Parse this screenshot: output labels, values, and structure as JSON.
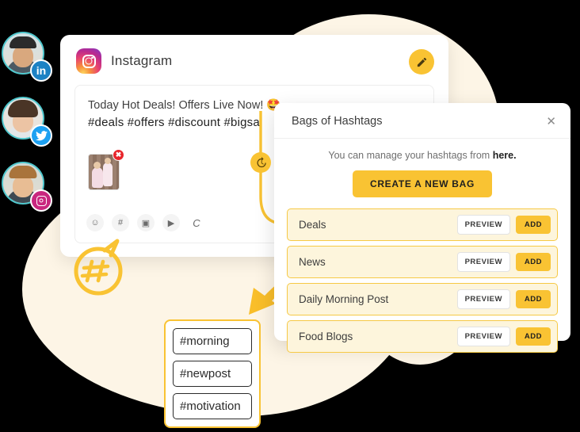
{
  "avatars": [
    {
      "name": "avatar-linkedin",
      "network": "LinkedIn",
      "badge": "in"
    },
    {
      "name": "avatar-twitter",
      "network": "Twitter",
      "badge": "twitter-icon"
    },
    {
      "name": "avatar-instagram",
      "network": "Instagram",
      "badge": "instagram-icon"
    }
  ],
  "composer": {
    "platform": "Instagram",
    "platform_icon": "instagram-logo",
    "edit_icon": "pencil-icon",
    "post_line_1": "Today Hot Deals!  Offers Live Now! 🤩",
    "post_line_2": "#deals #offers #discount #bigsal",
    "attachment_remove": "✖",
    "toolbar": [
      {
        "icon": "emoji-icon",
        "glyph": "☺"
      },
      {
        "icon": "hashtag-icon",
        "glyph": "#"
      },
      {
        "icon": "image-icon",
        "glyph": "▣"
      },
      {
        "icon": "video-icon",
        "glyph": "▶"
      },
      {
        "icon": "character-count-icon",
        "glyph": "C"
      }
    ]
  },
  "history_badge": {
    "icon": "history-clock-icon",
    "glyph": "↺"
  },
  "hash_bubble": {
    "icon": "hashtag-bubble-icon"
  },
  "chips_card": {
    "chips": [
      {
        "label": "#morning"
      },
      {
        "label": "#newpost"
      },
      {
        "label": "#motivation"
      }
    ]
  },
  "bags_panel": {
    "title": "Bags of Hashtags",
    "close_icon": "close-icon",
    "close_glyph": "✕",
    "subtitle_prefix": "You can manage your hashtags from ",
    "subtitle_link": "here.",
    "create_label": "CREATE A NEW BAG",
    "preview_label": "PREVIEW",
    "add_label": "ADD",
    "bags": [
      {
        "name": "Deals"
      },
      {
        "name": "News"
      },
      {
        "name": "Daily Morning Post"
      },
      {
        "name": "Food Blogs"
      }
    ]
  },
  "colors": {
    "accent": "#F9C333",
    "cream": "#FDF5E6",
    "bag_row_bg": "#FDF5DC",
    "bag_row_border": "#F6C945",
    "badge_linkedin": "#1C82C4",
    "badge_twitter": "#1DA1F2",
    "badge_instagram": "#C9277F",
    "remove_badge": "#E8252B"
  }
}
